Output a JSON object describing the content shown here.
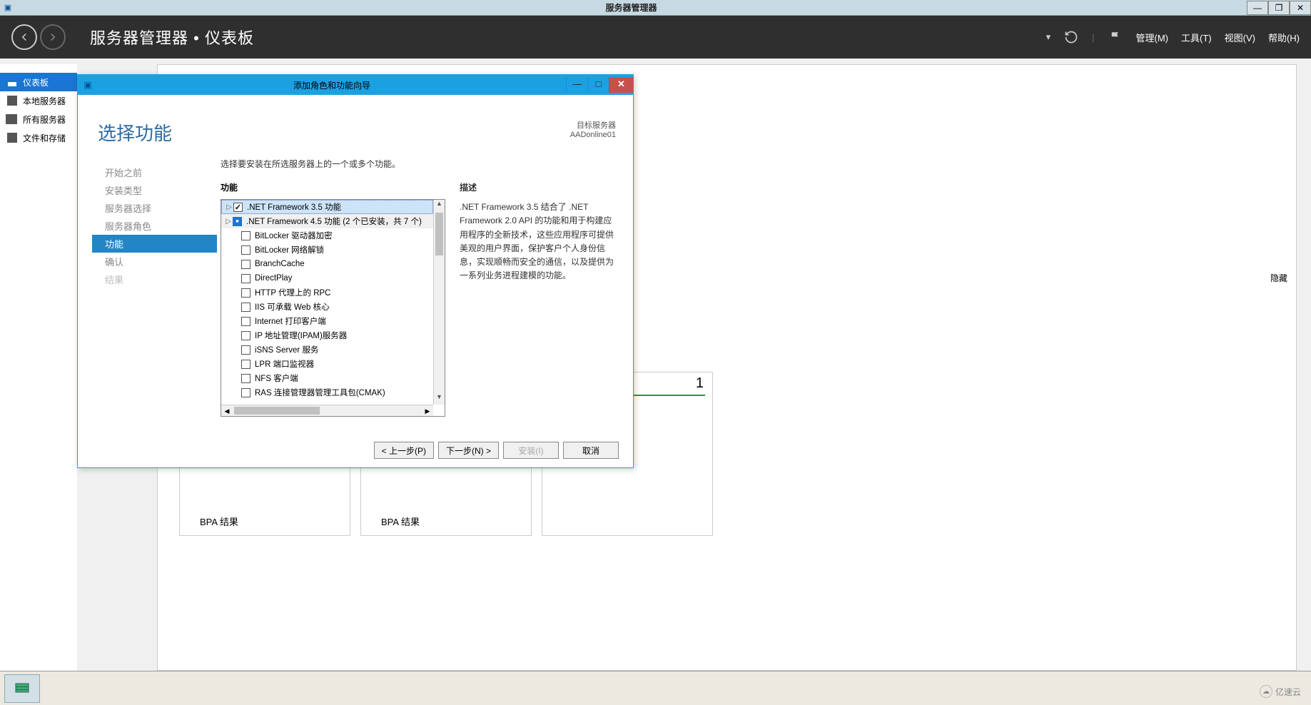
{
  "window": {
    "title": "服务器管理器"
  },
  "header": {
    "breadcrumb_app": "服务器管理器",
    "breadcrumb_sep": "•",
    "breadcrumb_page": "仪表板",
    "menus": {
      "manage": "管理(M)",
      "tools": "工具(T)",
      "view": "视图(V)",
      "help": "帮助(H)"
    }
  },
  "sidebar": {
    "items": [
      {
        "label": "仪表板"
      },
      {
        "label": "本地服务器"
      },
      {
        "label": "所有服务器"
      },
      {
        "label": "文件和存储"
      }
    ]
  },
  "main": {
    "hide": "隐藏",
    "count": "1",
    "bpa": "BPA 结果"
  },
  "dialog": {
    "title": "添加角色和功能向导",
    "heading": "选择功能",
    "target_label": "目标服务器",
    "target_server": "AADonline01",
    "nav": {
      "before": "开始之前",
      "install_type": "安装类型",
      "server_sel": "服务器选择",
      "server_roles": "服务器角色",
      "features": "功能",
      "confirm": "确认",
      "results": "结果"
    },
    "instruction": "选择要安装在所选服务器上的一个或多个功能。",
    "col_features": "功能",
    "col_desc": "描述",
    "features": [
      {
        "label": ".NET Framework 3.5 功能",
        "state": "checked",
        "expandable": true,
        "selected": true
      },
      {
        "label": ".NET Framework 4.5 功能 (2 个已安装，共 7 个)",
        "state": "partial",
        "expandable": true,
        "installed": true
      },
      {
        "label": "BitLocker 驱动器加密",
        "state": ""
      },
      {
        "label": "BitLocker 网络解锁",
        "state": ""
      },
      {
        "label": "BranchCache",
        "state": ""
      },
      {
        "label": "DirectPlay",
        "state": ""
      },
      {
        "label": "HTTP 代理上的 RPC",
        "state": ""
      },
      {
        "label": "IIS 可承载 Web 核心",
        "state": ""
      },
      {
        "label": "Internet 打印客户端",
        "state": ""
      },
      {
        "label": "IP 地址管理(IPAM)服务器",
        "state": ""
      },
      {
        "label": "iSNS Server 服务",
        "state": ""
      },
      {
        "label": "LPR 端口监视器",
        "state": ""
      },
      {
        "label": "NFS 客户端",
        "state": ""
      },
      {
        "label": "RAS 连接管理器管理工具包(CMAK)",
        "state": ""
      }
    ],
    "description": ".NET Framework 3.5 结合了 .NET Framework 2.0 API 的功能和用于构建应用程序的全新技术，这些应用程序可提供美观的用户界面，保护客户个人身份信息，实现顺畅而安全的通信，以及提供为一系列业务进程建模的功能。",
    "buttons": {
      "prev": "< 上一步(P)",
      "next": "下一步(N) >",
      "install": "安装(I)",
      "cancel": "取消"
    }
  },
  "watermark": "亿速云"
}
